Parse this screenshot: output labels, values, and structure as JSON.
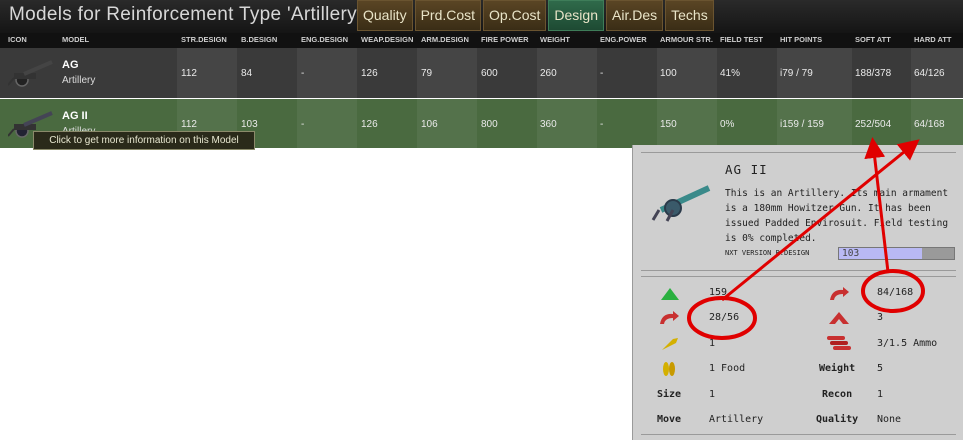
{
  "header": {
    "title": "Models for Reinforcement Type 'Artillery'",
    "tabs": [
      "Quality",
      "Prd.Cost",
      "Op.Cost",
      "Design",
      "Air.Des",
      "Techs"
    ],
    "active_tab": "Design"
  },
  "columns": [
    "ICON",
    "MODEL",
    "STR.DESIGN",
    "B.DESIGN",
    "ENG.DESIGN",
    "WEAP.DESIGN",
    "ARM.DESIGN",
    "FIRE POWER",
    "WEIGHT",
    "ENG.POWER",
    "ARMOUR STR.",
    "FIELD TEST",
    "HIT POINTS",
    "SOFT ATT",
    "HARD ATT"
  ],
  "rows": [
    {
      "name": "AG",
      "type": "Artillery",
      "str_design": "112",
      "b_design": "84",
      "eng_design": "-",
      "weap_design": "126",
      "arm_design": "79",
      "fire_power": "600",
      "weight": "260",
      "eng_power": "-",
      "armour_str": "100",
      "field_test": "41%",
      "hit_points": "i79 / 79",
      "soft_att": "188/378",
      "hard_att": "64/126"
    },
    {
      "name": "AG II",
      "type": "Artillery",
      "str_design": "112",
      "b_design": "103",
      "eng_design": "-",
      "weap_design": "126",
      "arm_design": "106",
      "fire_power": "800",
      "weight": "360",
      "eng_power": "-",
      "armour_str": "150",
      "field_test": "0%",
      "hit_points": "i159 / 159",
      "soft_att": "252/504",
      "hard_att": "64/168"
    }
  ],
  "tooltip": "Click to get more information on this Model",
  "panel": {
    "name": "AG II",
    "description": "This is an Artillery. Its main armament is a 180mm Howitzer Gun. It has been issued Padded Envirosuit. Field testing is 0% completed.",
    "nxt_label": "NXT VERSION B.DESIGN",
    "nxt_value": "103",
    "stats": {
      "hp": "159",
      "soft": "28/56",
      "fuel": "1",
      "food": "1 Food",
      "size_label": "Size",
      "size": "1",
      "move_label": "Move",
      "move": "Artillery",
      "hard": "84/168",
      "armor": "3",
      "ammo": "3/1.5 Ammo",
      "weight_label": "Weight",
      "weight": "5",
      "recon_label": "Recon",
      "recon": "1",
      "quality_label": "Quality",
      "quality": "None"
    }
  },
  "annotation_color": "#e00000"
}
